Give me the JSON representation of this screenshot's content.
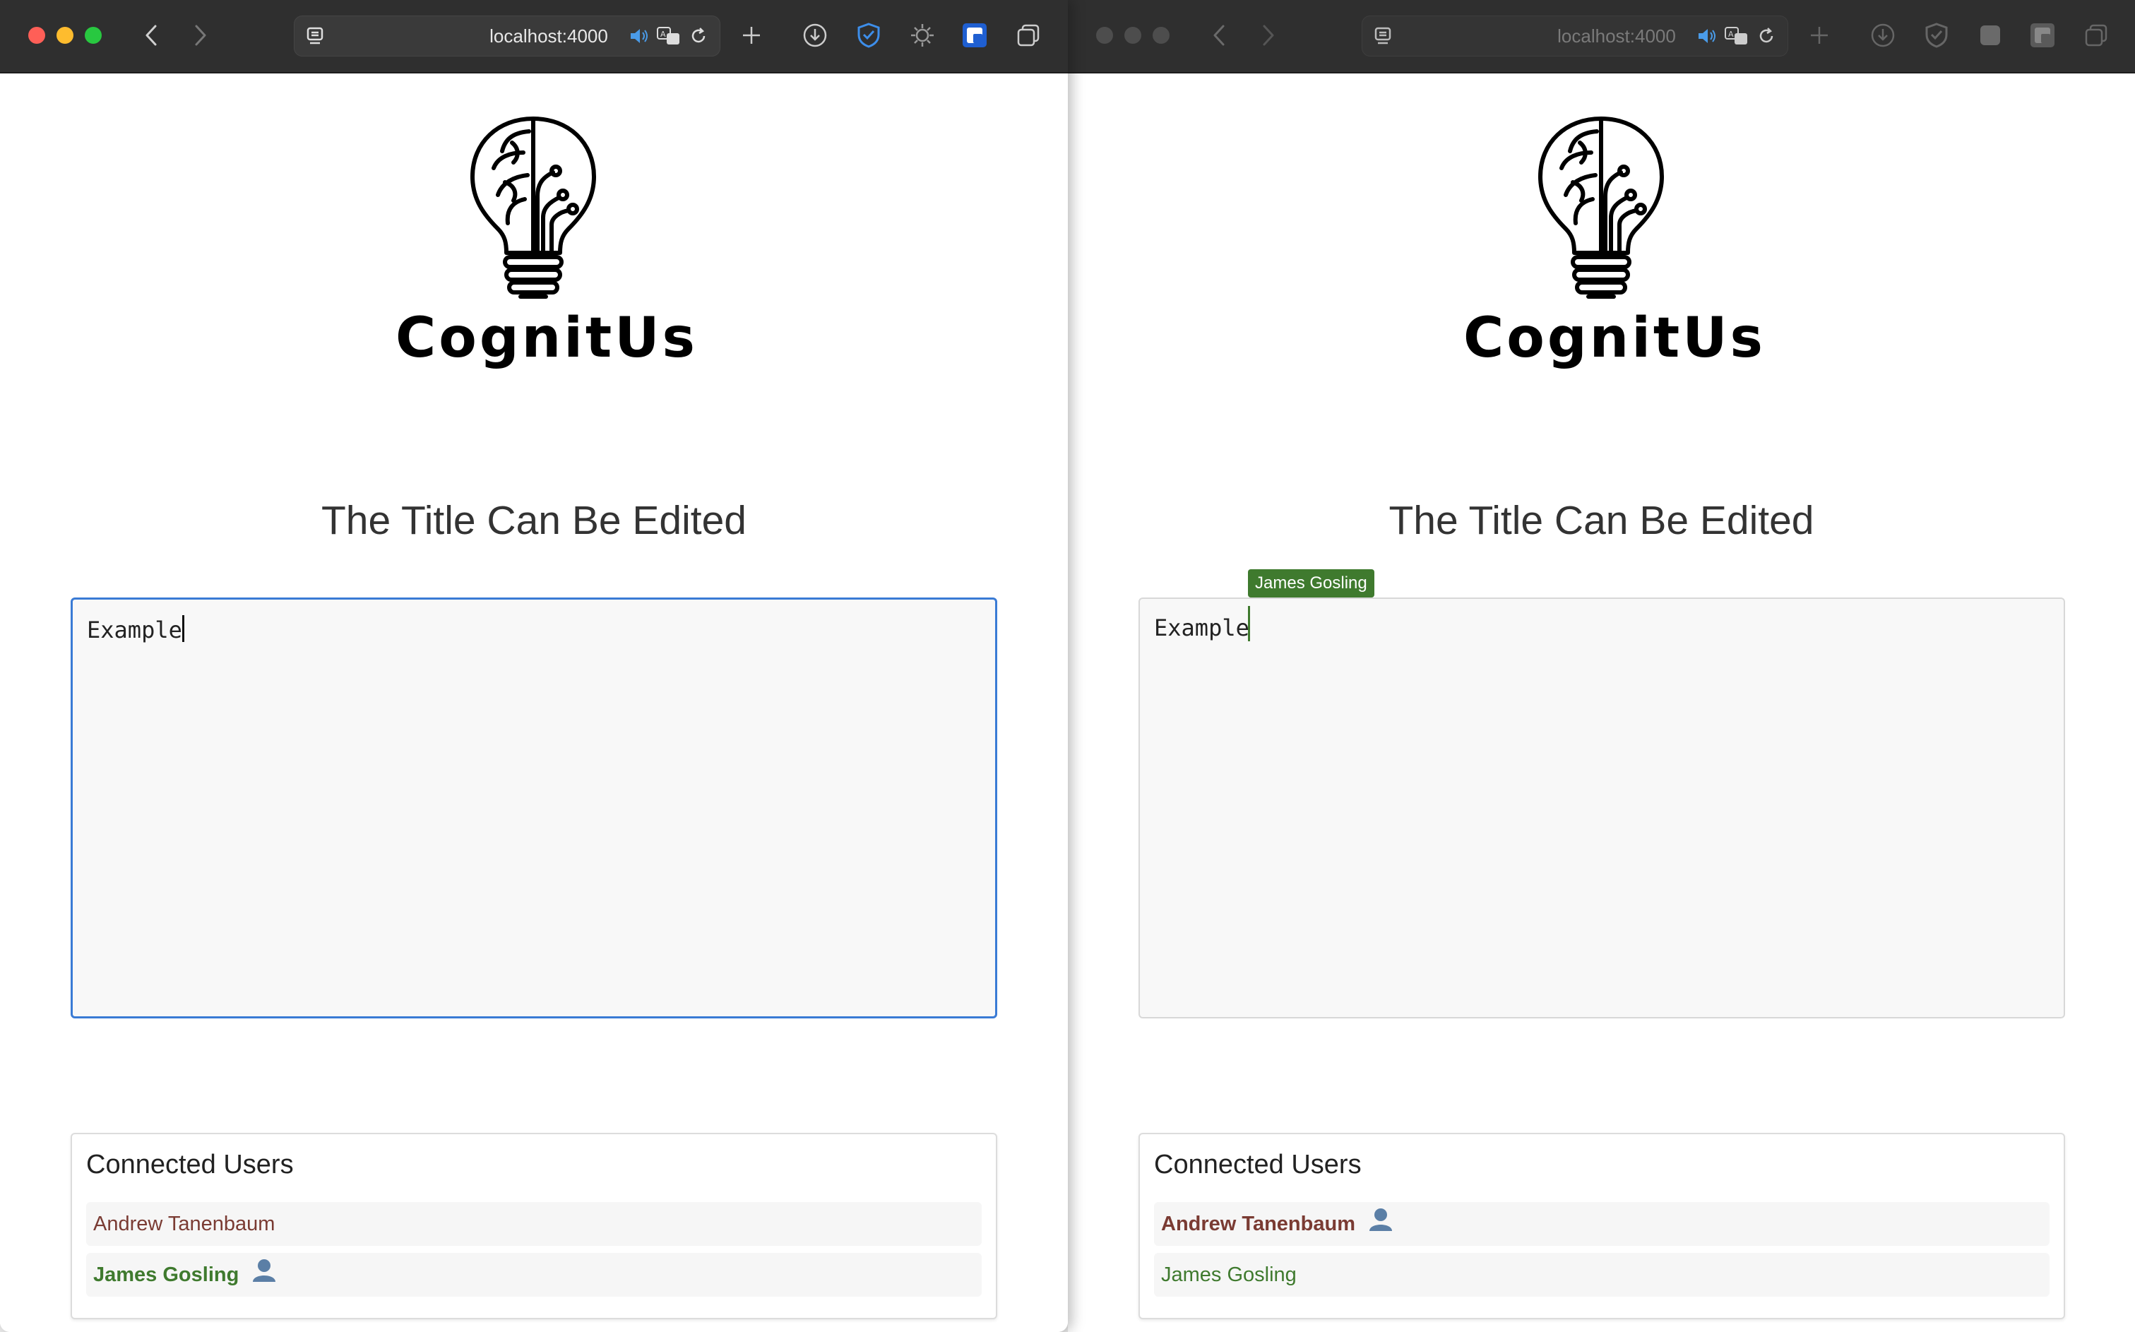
{
  "windows": [
    {
      "address": "localhost:4000",
      "brand": "CognitUs",
      "title": "The Title Can Be Edited",
      "editor": {
        "text": "Example",
        "focused": true
      },
      "users": {
        "heading": "Connected Users",
        "list": [
          {
            "name": "Andrew Tanenbaum",
            "color": "#7a3b33",
            "current": false
          },
          {
            "name": "James Gosling",
            "color": "#3f7a2e",
            "current": true
          }
        ]
      }
    },
    {
      "address": "localhost:4000",
      "brand": "CognitUs",
      "title": "The Title Can Be Edited",
      "editor": {
        "text": "Example",
        "focused": false,
        "remote_cursor_label": "James Gosling"
      },
      "users": {
        "heading": "Connected Users",
        "list": [
          {
            "name": "Andrew Tanenbaum",
            "color": "#7a3b33",
            "current": true
          },
          {
            "name": "James Gosling",
            "color": "#3f7a2e",
            "current": false
          }
        ]
      }
    }
  ],
  "colors": {
    "accent": "#3a7bd5",
    "toolbar": "#2f2f2f",
    "shield": "#3d8eea"
  },
  "icons": [
    "back-icon",
    "forward-icon",
    "sidebar-icon",
    "speaker-icon",
    "translate-icon",
    "reload-icon",
    "plus-icon",
    "download-icon",
    "shield-icon",
    "extension-icon",
    "privacy-icon",
    "tabs-icon",
    "person-icon"
  ]
}
